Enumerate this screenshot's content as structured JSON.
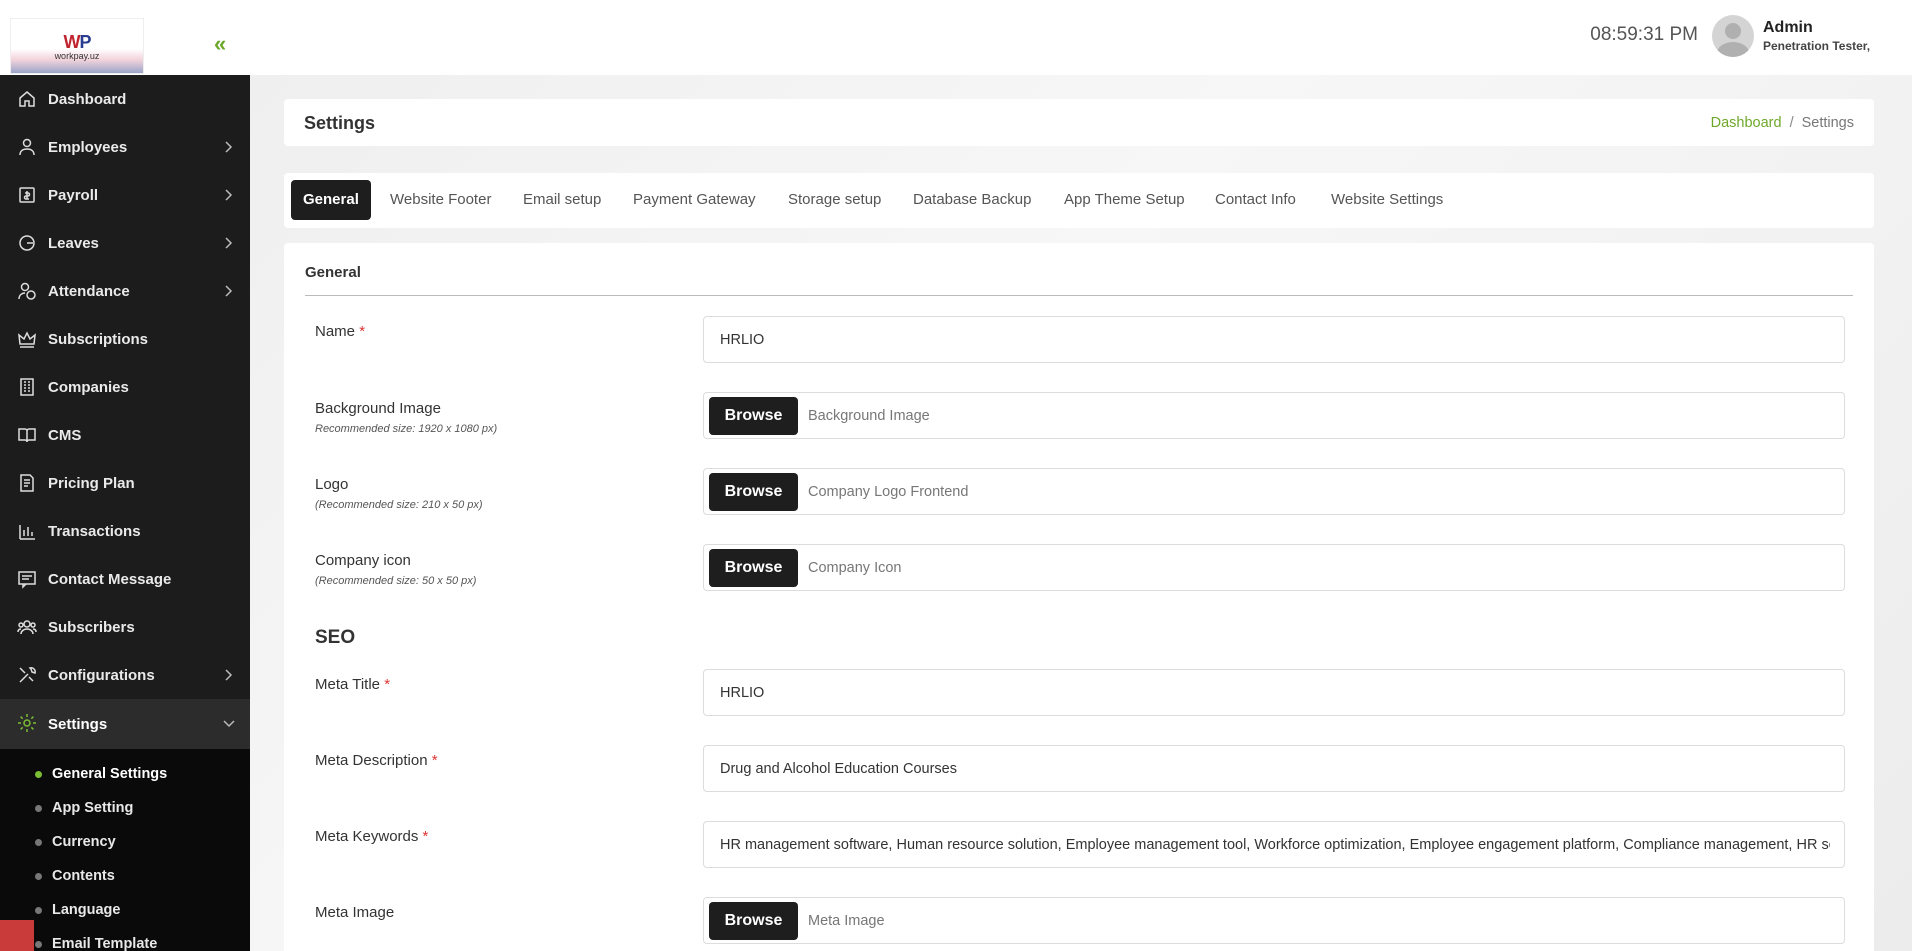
{
  "header": {
    "logo_text": "workpay.uz",
    "time": "08:59:31 PM",
    "user_name": "Admin",
    "user_role": "Penetration Tester,"
  },
  "sidebar": {
    "items": [
      {
        "label": "Dashboard",
        "icon": "home-icon",
        "has_children": false
      },
      {
        "label": "Employees",
        "icon": "user-icon",
        "has_children": true
      },
      {
        "label": "Payroll",
        "icon": "payroll-icon",
        "has_children": true
      },
      {
        "label": "Leaves",
        "icon": "leave-icon",
        "has_children": true
      },
      {
        "label": "Attendance",
        "icon": "attendance-icon",
        "has_children": true
      },
      {
        "label": "Subscriptions",
        "icon": "crown-icon",
        "has_children": false
      },
      {
        "label": "Companies",
        "icon": "building-icon",
        "has_children": false
      },
      {
        "label": "CMS",
        "icon": "book-icon",
        "has_children": false
      },
      {
        "label": "Pricing Plan",
        "icon": "pricing-icon",
        "has_children": false
      },
      {
        "label": "Transactions",
        "icon": "bar-chart-icon",
        "has_children": false
      },
      {
        "label": "Contact Message",
        "icon": "message-icon",
        "has_children": false
      },
      {
        "label": "Subscribers",
        "icon": "users-icon",
        "has_children": false
      },
      {
        "label": "Configurations",
        "icon": "tools-icon",
        "has_children": true
      },
      {
        "label": "Settings",
        "icon": "gear-icon",
        "has_children": true,
        "active": true
      }
    ],
    "submenu": [
      {
        "label": "General Settings",
        "active": true
      },
      {
        "label": "App Setting"
      },
      {
        "label": "Currency"
      },
      {
        "label": "Contents"
      },
      {
        "label": "Language"
      },
      {
        "label": "Email Template"
      }
    ]
  },
  "page": {
    "title": "Settings",
    "breadcrumb": [
      "Dashboard",
      "Settings"
    ]
  },
  "tabs": [
    {
      "label": "General",
      "active": true
    },
    {
      "label": "Website Footer"
    },
    {
      "label": "Email setup"
    },
    {
      "label": "Payment Gateway"
    },
    {
      "label": "Storage setup"
    },
    {
      "label": "Database Backup"
    },
    {
      "label": "App Theme Setup"
    },
    {
      "label": "Contact Info"
    },
    {
      "label": "Website Settings"
    }
  ],
  "form": {
    "section_title": "General",
    "seo_title": "SEO",
    "browse_label": "Browse",
    "name": {
      "label": "Name",
      "required": "*",
      "value": "HRLIO"
    },
    "background_image": {
      "label": "Background Image",
      "hint": "Recommended size: 1920 x 1080 px)",
      "placeholder": "Background Image"
    },
    "logo": {
      "label": "Logo",
      "hint": "(Recommended size: 210 x 50 px)",
      "placeholder": "Company Logo Frontend"
    },
    "company_icon": {
      "label": "Company icon",
      "hint": "(Recommended size: 50 x 50 px)",
      "placeholder": "Company Icon"
    },
    "meta_title": {
      "label": "Meta Title",
      "required": "*",
      "value": "HRLIO"
    },
    "meta_description": {
      "label": "Meta Description",
      "required": "*",
      "value": "Drug and Alcohol Education Courses"
    },
    "meta_keywords": {
      "label": "Meta Keywords",
      "required": "*",
      "value": "HR management software, Human resource solution, Employee management tool, Workforce optimization, Employee engagement platform, Compliance management, HR software"
    },
    "meta_image": {
      "label": "Meta Image",
      "placeholder": "Meta Image"
    }
  },
  "colors": {
    "accent": "#6ea82b",
    "sidebar_bg": "#1c1c1c",
    "active_tab_bg": "#1e1e1e",
    "required": "#d33333"
  }
}
